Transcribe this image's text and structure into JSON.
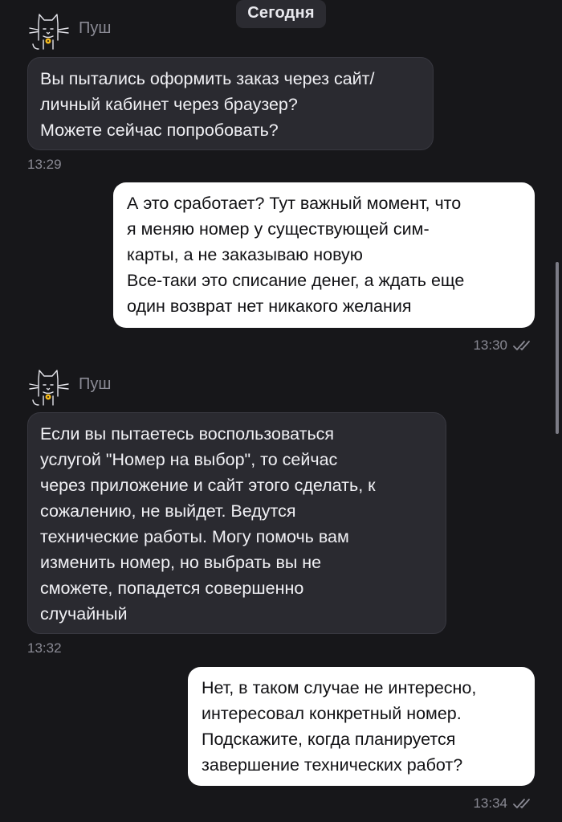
{
  "chat": {
    "date_label": "Сегодня"
  },
  "messages": [
    {
      "direction": "incoming",
      "sender": "Пуш",
      "text": "Вы пытались оформить заказ через сайт/\nличный кабинет через браузер?\nМожете сейчас попробовать?",
      "time": "13:29"
    },
    {
      "direction": "outgoing",
      "text": "А это сработает? Тут важный момент, что\nя меняю номер у существующей сим-\nкарты, а не заказываю новую\nВсе-таки это списание денег, а ждать еще\nодин возврат нет никакого желания",
      "time": "13:30",
      "status": "read"
    },
    {
      "direction": "incoming",
      "sender": "Пуш",
      "text": "Если вы пытаетесь воспользоваться\nуслугой \"Номер на выбор\", то сейчас\nчерез приложение и сайт этого сделать, к\nсожалению, не выйдет. Ведутся\nтехнические работы. Могу помочь вам\nизменить номер, но выбрать вы не\nсможете, попадется совершенно\nслучайный",
      "time": "13:32"
    },
    {
      "direction": "outgoing",
      "text": "Нет, в таком случае не интересно,\nинтересовал конкретный номер.\nПодскажите, когда планируется\nзавершение технических работ?",
      "time": "13:34",
      "status": "read"
    }
  ],
  "icons": {
    "avatar": "cat-avatar-icon",
    "read_status": "double-check-icon"
  },
  "colors": {
    "background": "#17171a",
    "incoming_bubble": "#2a2a30",
    "outgoing_bubble": "#ffffff",
    "secondary_text": "#8a8a94"
  }
}
